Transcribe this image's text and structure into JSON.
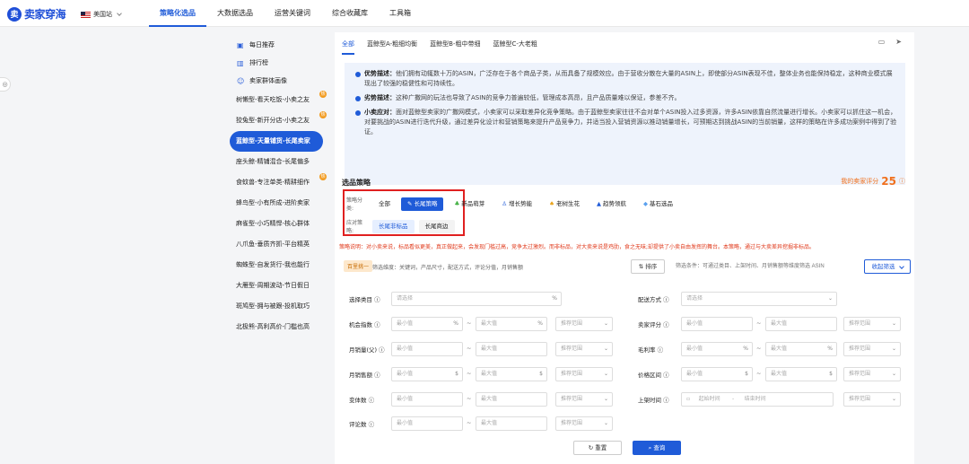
{
  "app": {
    "logo_mark": "卖",
    "logo_text": "卖家穿海",
    "market": "美国站"
  },
  "nav": [
    "策略化选品",
    "大数据选品",
    "运营关键词",
    "综合收藏库",
    "工具箱"
  ],
  "sidebar": {
    "links": [
      {
        "label": "每日推荐",
        "icon": "calendar-icon"
      },
      {
        "label": "排行榜",
        "icon": "chart-icon"
      },
      {
        "label": "卖家群体画像",
        "icon": "users-icon"
      }
    ],
    "segments": [
      "树懒型-看天吃饭-小卖之友",
      "狡兔型-新开分店-小卖之友",
      "蓝鲸型-天量铺货-长尾卖家",
      "座头鲸-精铺混合-长尾偏多",
      "食蚊兽-专注单类-精耕细作",
      "蜂鸟型-小有所成-进阶卖家",
      "麻雀型-小巧精悍-核心群体",
      "八爪鱼-垂质齐抓-平台精英",
      "蜘蛛型-自发货行-我也能行",
      "大雁型-周期波动-节日假日",
      "斑鸠型-拥与被跟-投机取巧",
      "北极熊-高利高价-门槛也高"
    ],
    "hot_badge": "热"
  },
  "tabs": [
    "全部",
    "蓝鲸型A-粗细均衡",
    "蓝鲸型B-粗中带细",
    "蓝鲸型C-大老粗"
  ],
  "desc": [
    {
      "title": "优势描述：",
      "text": "他们拥有动辄数十万的ASIN，广泛存在于各个商品子类，从而具备了规模效应。由于营收分散在大量的ASIN上，即使部分ASIN表现不佳，整体业务也能保持稳定，这种商业模式展现出了较强的稳健性和可持续性。"
    },
    {
      "title": "劣势描述：",
      "text": "这种广撒网的玩法也导致了ASIN的竞争力普遍较低，管理成本高昂，且产品质量难以保证，参差不齐。"
    },
    {
      "title": "小卖应对：",
      "text": "面对蓝鲸型卖家的广撒网模式，小卖家可以采取差异化竞争策略。由于蓝鲸型卖家往往不会对单个ASIN投入过多资源，许多ASIN依靠自然流量进行增长。小卖家可以抓住这一机会，对要挑战的ASIN进行迭代升级，通过差异化设计和营销策略来提升产品竞争力，并适当投入营销资源以推动销量增长，可预期达到挑战ASIN的当前销量，这样的策略在许多成功案例中得到了验证。"
    }
  ],
  "strategy": {
    "title": "选品策略",
    "rating_label": "我的卖家评分",
    "rating_value": "25",
    "cat_label": "策略分类:",
    "cats": [
      "全部",
      "长尾策略",
      "新品萌芽",
      "增长势能",
      "老树生花",
      "趋势领航",
      "基石选品"
    ],
    "resp_label": "应对策略:",
    "resps": [
      "长尾非标品",
      "长尾商边"
    ],
    "note": "策略说明：对小卖来说，标品看似更美，真正做起来，会发现门槛过高，竞争太过激烈。而非标品，对大卖来说是鸡肋，食之无味;却提供了小卖自由发挥的舞台。本策略，通过与大卖差异挖掘非标品。"
  },
  "search": {
    "tag": "百里挑一",
    "hint": "筛选维度：关键词，产品尺寸，配送方式，评论分值，月销售额",
    "sort": "排序",
    "placeholder": "筛选条件：可通过类目、上架时间、月销售额等维度筛选 ASIN",
    "collapse": "收起筛选"
  },
  "filters": {
    "category": "选择类目",
    "category_ph": "请选择",
    "delivery": "配送方式",
    "delivery_ph": "请选择",
    "opp": "机会指数",
    "seller": "卖家评分",
    "msales": "月销量(父)",
    "margin": "毛利率",
    "mrev": "月销售额",
    "price": "价格区间",
    "variants": "变体数",
    "listed": "上架时间",
    "reviews": "评论数",
    "min": "最小值",
    "max": "最大值",
    "rec": "推荐范围",
    "start": "起始时间",
    "end": "结束时间",
    "pct": "%",
    "usd": "$",
    "tilde": "~",
    "dash": "-"
  },
  "buttons": {
    "reset": "重置",
    "query": "查询"
  },
  "colors": {
    "accent": "#1f5bd8",
    "warning": "#e0391b",
    "rating": "#f0701d"
  }
}
